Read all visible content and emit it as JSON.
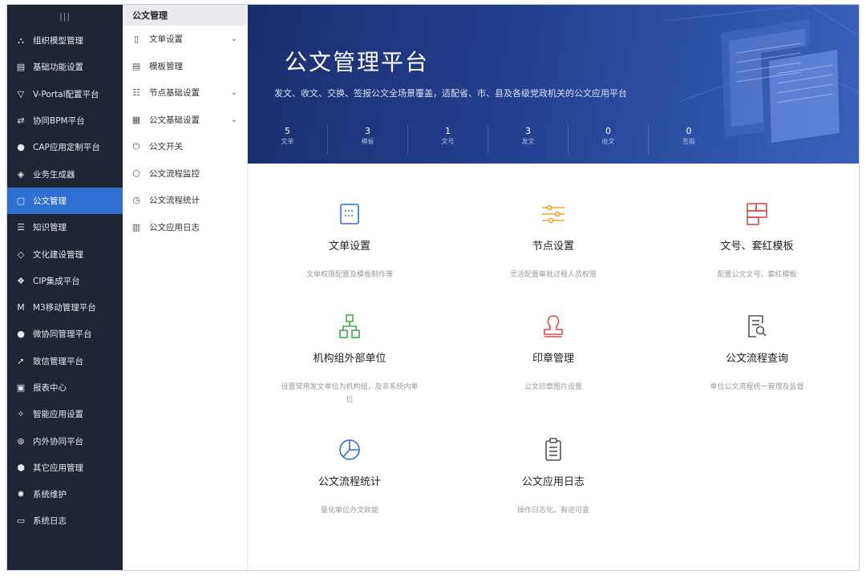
{
  "sidebar": {
    "collapse_glyph": "|||",
    "items": [
      {
        "label": "组织模型管理",
        "icon": "org-tree-icon",
        "glyph": "⛬"
      },
      {
        "label": "基础功能设置",
        "icon": "settings-card-icon",
        "glyph": "▤"
      },
      {
        "label": "V-Portal配置平台",
        "icon": "portal-icon",
        "glyph": "▽"
      },
      {
        "label": "协同BPM平台",
        "icon": "bpm-icon",
        "glyph": "⇄"
      },
      {
        "label": "CAP应用定制平台",
        "icon": "cap-icon",
        "glyph": "●"
      },
      {
        "label": "业务生成器",
        "icon": "cube-icon",
        "glyph": "◈"
      },
      {
        "label": "公文管理",
        "icon": "document-icon",
        "glyph": "▢"
      },
      {
        "label": "知识管理",
        "icon": "knowledge-icon",
        "glyph": "☰"
      },
      {
        "label": "文化建设管理",
        "icon": "culture-icon",
        "glyph": "◇"
      },
      {
        "label": "CIP集成平台",
        "icon": "cip-icon",
        "glyph": "❖"
      },
      {
        "label": "M3移动管理平台",
        "icon": "m3-icon",
        "glyph": "M"
      },
      {
        "label": "微协同管理平台",
        "icon": "chat-icon",
        "glyph": "●"
      },
      {
        "label": "致信管理平台",
        "icon": "send-icon",
        "glyph": "➚"
      },
      {
        "label": "报表中心",
        "icon": "report-icon",
        "glyph": "▣"
      },
      {
        "label": "智能应用设置",
        "icon": "smart-icon",
        "glyph": "✧"
      },
      {
        "label": "内外协同平台",
        "icon": "collab-icon",
        "glyph": "⊛"
      },
      {
        "label": "其它应用管理",
        "icon": "apps-icon",
        "glyph": "⬢"
      },
      {
        "label": "系统维护",
        "icon": "gear-icon",
        "glyph": "✸"
      },
      {
        "label": "系统日志",
        "icon": "log-icon",
        "glyph": "▭"
      }
    ],
    "active_index": 6
  },
  "submenu": {
    "title": "公文管理",
    "items": [
      {
        "label": "文单设置",
        "icon": "form-icon",
        "glyph": "▯",
        "expandable": true
      },
      {
        "label": "模板管理",
        "icon": "template-icon",
        "glyph": "▤",
        "expandable": false
      },
      {
        "label": "节点基础设置",
        "icon": "node-settings-icon",
        "glyph": "☷",
        "expandable": true
      },
      {
        "label": "公文基础设置",
        "icon": "doc-settings-icon",
        "glyph": "▦",
        "expandable": true
      },
      {
        "label": "公文开关",
        "icon": "power-icon",
        "glyph": "⏻",
        "expandable": false
      },
      {
        "label": "公文流程监控",
        "icon": "monitor-icon",
        "glyph": "⬡",
        "expandable": false
      },
      {
        "label": "公文流程统计",
        "icon": "clock-icon",
        "glyph": "◷",
        "expandable": false
      },
      {
        "label": "公文应用日志",
        "icon": "log-book-icon",
        "glyph": "▥",
        "expandable": false
      }
    ]
  },
  "banner": {
    "title": "公文管理平台",
    "subtitle": "发文、收文、交换、签报公文全场景覆盖，适配省、市、县及各级党政机关的公文应用平台",
    "stats": [
      {
        "value": "5",
        "label": "文单"
      },
      {
        "value": "3",
        "label": "模板"
      },
      {
        "value": "1",
        "label": "文号"
      },
      {
        "value": "3",
        "label": "发文"
      },
      {
        "value": "0",
        "label": "收文"
      },
      {
        "value": "0",
        "label": "签报"
      }
    ]
  },
  "cards": [
    {
      "title": "文单设置",
      "desc": "文单权限配置及模板制作等",
      "icon": "form-card-icon",
      "color": "#2f6fd2"
    },
    {
      "title": "节点设置",
      "desc": "灵活配置审批过程人员权限",
      "icon": "sliders-icon",
      "color": "#f0a52a"
    },
    {
      "title": "文号、套红模板",
      "desc": "配置公文文号、套红模板",
      "icon": "red-template-icon",
      "color": "#e04a4a"
    },
    {
      "title": "机构组外部单位",
      "desc": "设置常用发文单位为机构组，及非系统内单位",
      "icon": "org-chart-icon",
      "color": "#3fae49"
    },
    {
      "title": "印章管理",
      "desc": "公文印章图片设置",
      "icon": "seal-icon",
      "color": "#e04a4a"
    },
    {
      "title": "公文流程查询",
      "desc": "单位公文流程统一管理及监督",
      "icon": "doc-search-icon",
      "color": "#555555"
    },
    {
      "title": "公文流程统计",
      "desc": "量化单位办文效能",
      "icon": "pie-chart-icon",
      "color": "#2f6fd2"
    },
    {
      "title": "公文应用日志",
      "desc": "操作日志化，有迹可查",
      "icon": "clipboard-icon",
      "color": "#555555"
    }
  ]
}
